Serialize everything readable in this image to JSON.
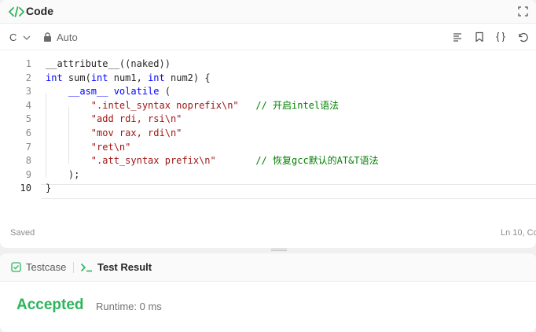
{
  "header": {
    "title": "Code",
    "icons": {
      "code": "code-brackets-icon",
      "expand": "expand-icon"
    }
  },
  "toolbar": {
    "language": "C",
    "mode": "Auto",
    "icons": [
      "format-icon",
      "bookmark-icon",
      "braces-icon",
      "undo-icon"
    ]
  },
  "editor": {
    "lines": [
      {
        "num": "1",
        "segments": [
          {
            "t": "__attribute__((naked))",
            "c": ""
          }
        ]
      },
      {
        "num": "2",
        "segments": [
          {
            "t": "int",
            "c": "ty"
          },
          {
            "t": " sum(",
            "c": ""
          },
          {
            "t": "int",
            "c": "ty"
          },
          {
            "t": " num1, ",
            "c": ""
          },
          {
            "t": "int",
            "c": "ty"
          },
          {
            "t": " num2) {",
            "c": ""
          }
        ]
      },
      {
        "num": "3",
        "segments": [
          {
            "t": "    __asm__ volatile",
            "c": "kw"
          },
          {
            "t": " (",
            "c": ""
          }
        ]
      },
      {
        "num": "4",
        "segments": [
          {
            "t": "        \".intel_syntax noprefix\\n\"",
            "c": "str"
          },
          {
            "t": "   // 开启intel语法",
            "c": "cmt"
          }
        ]
      },
      {
        "num": "5",
        "segments": [
          {
            "t": "        \"add rdi, rsi\\n\"",
            "c": "str"
          }
        ]
      },
      {
        "num": "6",
        "segments": [
          {
            "t": "        \"mov rax, rdi\\n\"",
            "c": "str"
          }
        ]
      },
      {
        "num": "7",
        "segments": [
          {
            "t": "        \"ret\\n\"",
            "c": "str"
          }
        ]
      },
      {
        "num": "8",
        "segments": [
          {
            "t": "        \".att_syntax prefix\\n\"",
            "c": "str"
          },
          {
            "t": "       // 恢复gcc默认的AT&T语法",
            "c": "cmt"
          }
        ]
      },
      {
        "num": "9",
        "segments": [
          {
            "t": "    );",
            "c": ""
          }
        ]
      },
      {
        "num": "10",
        "segments": [
          {
            "t": "}",
            "c": ""
          }
        ]
      }
    ],
    "current_line": "10"
  },
  "status": {
    "saved": "Saved",
    "position": "Ln 10, Co"
  },
  "result": {
    "tabs": [
      {
        "label": "Testcase",
        "icon": "checkbox-icon"
      },
      {
        "label": "Test Result",
        "icon": "terminal-icon"
      }
    ],
    "verdict": "Accepted",
    "runtime": "Runtime: 0 ms",
    "colors": {
      "accepted": "#2db55d",
      "testcase_icon": "#2db55d",
      "terminal_icon": "#2db55d"
    }
  }
}
